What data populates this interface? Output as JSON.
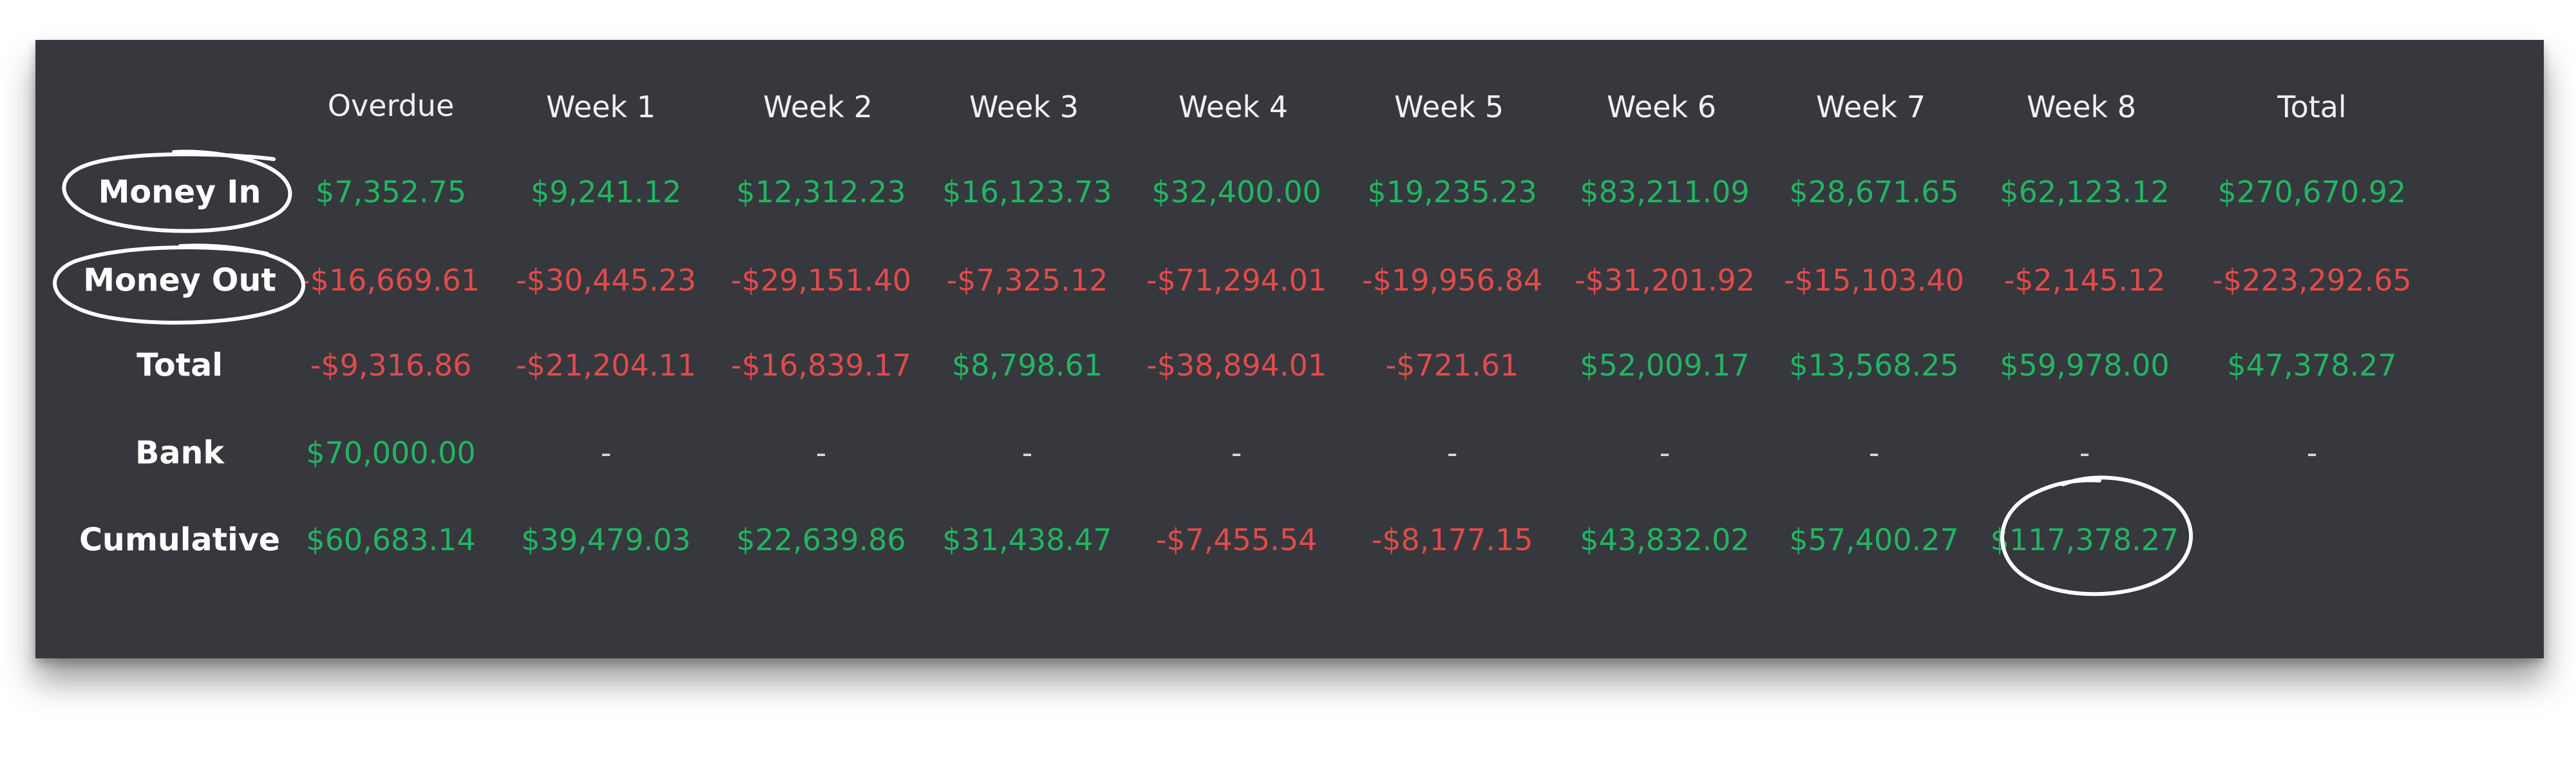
{
  "colors": {
    "panel_bg": "#36383d",
    "positive": "#23b463",
    "negative": "#e04b4b",
    "header_text": "#f1f1f1",
    "annotation": "#ffffff"
  },
  "table": {
    "columns": [
      "Overdue",
      "Week 1",
      "Week 2",
      "Week 3",
      "Week 4",
      "Week 5",
      "Week 6",
      "Week 7",
      "Week 8",
      "Total"
    ],
    "rows": [
      {
        "label": "Money In",
        "values": [
          "$7,352.75",
          "$9,241.12",
          "$12,312.23",
          "$16,123.73",
          "$32,400.00",
          "$19,235.23",
          "$83,211.09",
          "$28,671.65",
          "$62,123.12",
          "$270,670.92"
        ],
        "tone": [
          "pos",
          "pos",
          "pos",
          "pos",
          "pos",
          "pos",
          "pos",
          "pos",
          "pos",
          "pos"
        ]
      },
      {
        "label": "Money Out",
        "values": [
          "-$16,669.61",
          "-$30,445.23",
          "-$29,151.40",
          "-$7,325.12",
          "-$71,294.01",
          "-$19,956.84",
          "-$31,201.92",
          "-$15,103.40",
          "-$2,145.12",
          "-$223,292.65"
        ],
        "tone": [
          "neg",
          "neg",
          "neg",
          "neg",
          "neg",
          "neg",
          "neg",
          "neg",
          "neg",
          "neg"
        ]
      },
      {
        "label": "Total",
        "values": [
          "-$9,316.86",
          "-$21,204.11",
          "-$16,839.17",
          "$8,798.61",
          "-$38,894.01",
          "-$721.61",
          "$52,009.17",
          "$13,568.25",
          "$59,978.00",
          "$47,378.27"
        ],
        "tone": [
          "neg",
          "neg",
          "neg",
          "pos",
          "neg",
          "neg",
          "pos",
          "pos",
          "pos",
          "pos"
        ]
      },
      {
        "label": "Bank",
        "values": [
          "$70,000.00",
          "-",
          "-",
          "-",
          "-",
          "-",
          "-",
          "-",
          "-",
          "-"
        ],
        "tone": [
          "pos",
          "dash",
          "dash",
          "dash",
          "dash",
          "dash",
          "dash",
          "dash",
          "dash",
          "dash"
        ]
      },
      {
        "label": "Cumulative",
        "values": [
          "$60,683.14",
          "$39,479.03",
          "$22,639.86",
          "$31,438.47",
          "-$7,455.54",
          "-$8,177.15",
          "$43,832.02",
          "$57,400.27",
          "$117,378.27"
        ],
        "tone": [
          "pos",
          "pos",
          "pos",
          "pos",
          "neg",
          "neg",
          "pos",
          "pos",
          "pos"
        ]
      }
    ]
  },
  "annotations": [
    {
      "kind": "ellipse",
      "target": "Money In"
    },
    {
      "kind": "ellipse",
      "target": "Money Out"
    },
    {
      "kind": "circle",
      "target": "$117,378.27"
    }
  ]
}
